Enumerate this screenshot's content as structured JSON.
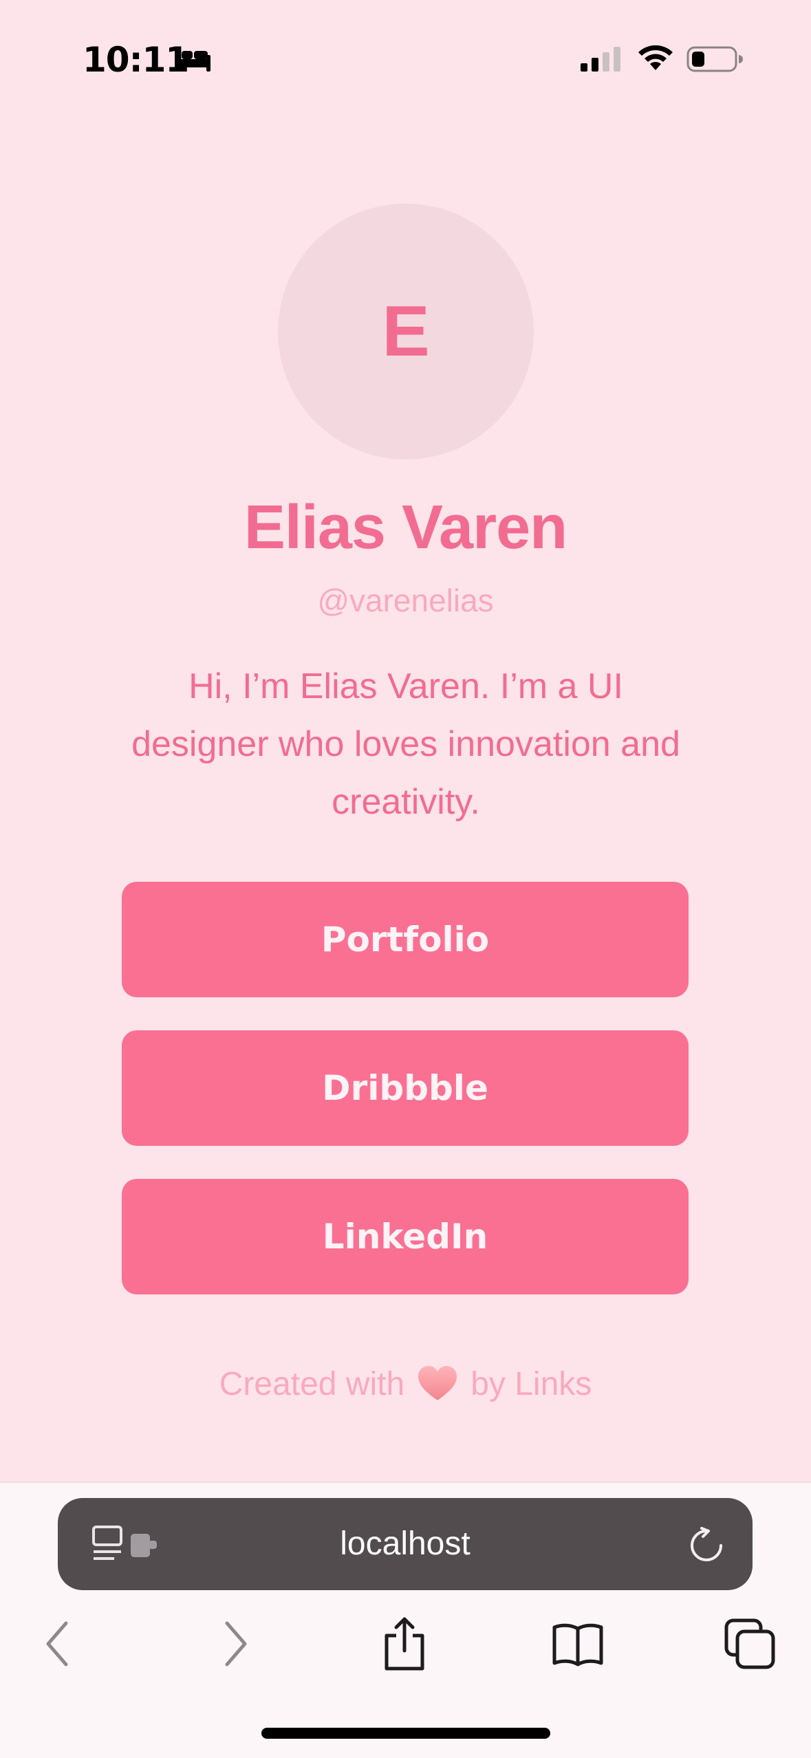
{
  "status_bar": {
    "time": "10:11",
    "focus_icon": "bed-icon",
    "signal_icon": "cellular-signal-icon",
    "wifi_icon": "wifi-icon",
    "battery_icon": "battery-icon"
  },
  "profile": {
    "avatar_initial": "E",
    "name": "Elias Varen",
    "handle": "@varenelias",
    "bio": "Hi, I’m Elias Varen. I’m a UI designer who loves innovation and creativity."
  },
  "links": [
    {
      "label": "Portfolio"
    },
    {
      "label": "Dribbble"
    },
    {
      "label": "LinkedIn"
    }
  ],
  "footer": {
    "prefix": "Created with",
    "heart_icon": "heart-icon",
    "suffix": "by Links"
  },
  "browser": {
    "address": "localhost",
    "page_menu_icon": "page-menu-icon",
    "reload_icon": "reload-icon",
    "nav_icons": [
      "back-icon",
      "forward-icon",
      "share-icon",
      "bookmarks-icon",
      "tabs-icon"
    ]
  },
  "colors": {
    "background": "#fde4ea",
    "accent": "#fa7093",
    "accent_text": "#f26c91",
    "muted_text": "#f8a9c0",
    "avatar_bg": "#f3d9df",
    "address_bar": "#524c4e"
  }
}
